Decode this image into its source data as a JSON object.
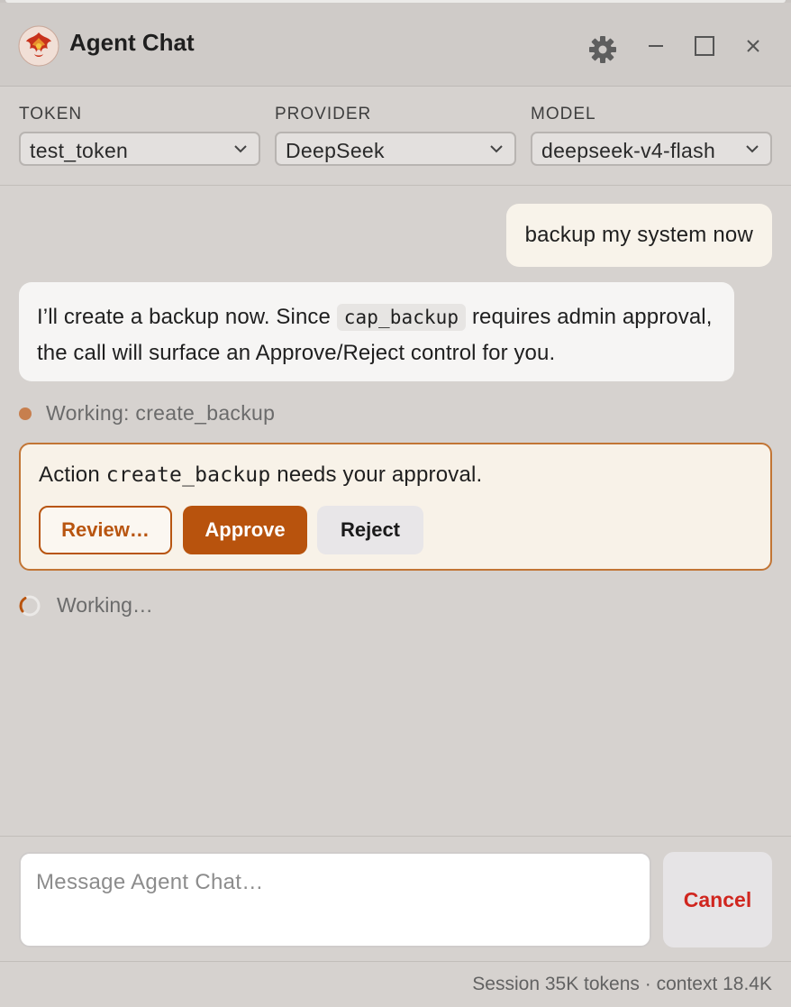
{
  "window": {
    "title": "Agent Chat",
    "controls": {
      "settings": "gear-icon",
      "minimize": "minimize-icon",
      "maximize": "maximize-icon",
      "close": "close-icon"
    }
  },
  "selectors": {
    "token": {
      "label": "TOKEN",
      "value": "test_token"
    },
    "provider": {
      "label": "PROVIDER",
      "value": "DeepSeek"
    },
    "model": {
      "label": "MODEL",
      "value": "deepseek-v4-flash"
    }
  },
  "messages": {
    "user": "backup my system now",
    "assistant": {
      "before_code": "I’ll create a backup now. Since ",
      "code": "cap_backup",
      "after_code": " requires admin approval, the call will surface an Approve/Reject control for you."
    }
  },
  "tool_status": {
    "text": "Working: create_backup",
    "dot_color": "#c77f4e"
  },
  "approval": {
    "prefix": "Action ",
    "action": "create_backup",
    "suffix": " needs your approval.",
    "buttons": {
      "review": "Review…",
      "approve": "Approve",
      "reject": "Reject"
    },
    "accent": "#b8530d"
  },
  "working_indicator": {
    "text": "Working…"
  },
  "composer": {
    "placeholder": "Message Agent Chat…",
    "value": "",
    "cancel_label": "Cancel",
    "cancel_color": "#d0261f"
  },
  "footer": {
    "usage": "Session 35K tokens · context 18.4K"
  }
}
